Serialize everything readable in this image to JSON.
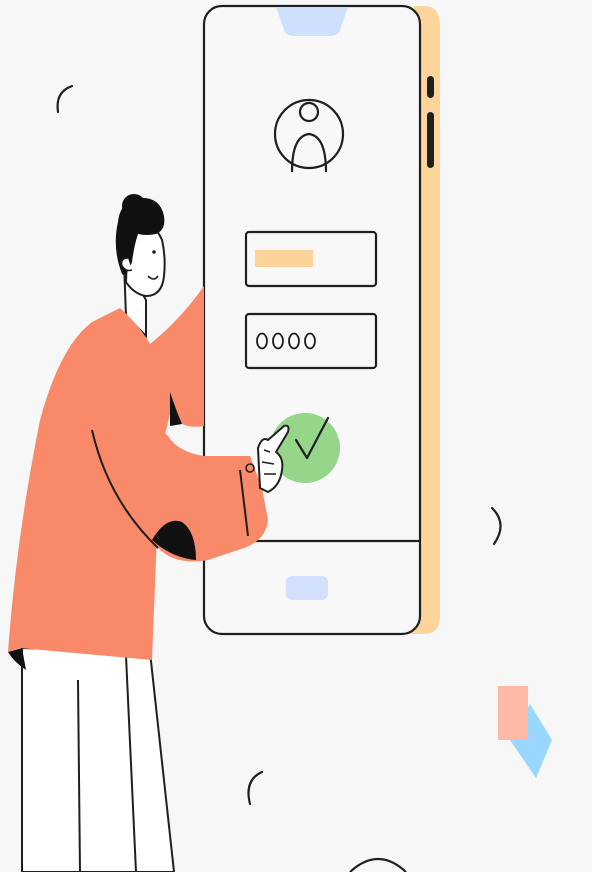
{
  "illustration": {
    "subject": "login-verification",
    "colors": {
      "background": "#f7f7f7",
      "outline": "#1f1f1f",
      "phone_screen": "#f8f8f8",
      "phone_side": "#fdd59a",
      "notch": "#cfe0ff",
      "home_button": "#d3e1ff",
      "username_bar": "#fcd49a",
      "check_circle": "#95d68a",
      "shirt": "#f98a69",
      "hair": "#111111",
      "skin": "#ffffff",
      "pants": "#ffffff",
      "pink_square": "#ffb9a6",
      "blue_diamond": "#9ad7ff"
    },
    "password_dots": 4,
    "icons": [
      "avatar-icon",
      "checkmark-icon"
    ]
  }
}
